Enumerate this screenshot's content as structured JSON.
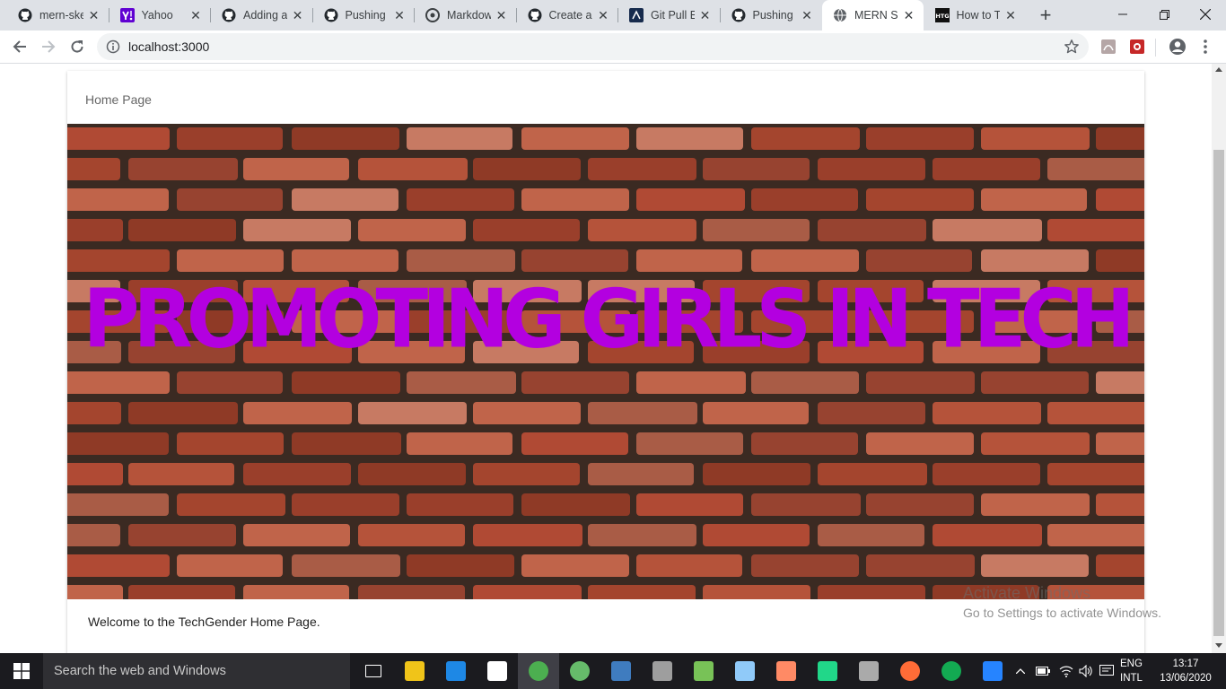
{
  "browser": {
    "tabs": [
      {
        "title": "mern-ske",
        "icon": "github-icon"
      },
      {
        "title": "Yahoo",
        "icon": "yahoo-icon"
      },
      {
        "title": "Adding a",
        "icon": "github-icon"
      },
      {
        "title": "Pushing",
        "icon": "github-icon"
      },
      {
        "title": "Markdow",
        "icon": "markdown-icon"
      },
      {
        "title": "Create a",
        "icon": "github-icon"
      },
      {
        "title": "Git Pull E",
        "icon": "atlassian-icon"
      },
      {
        "title": "Pushing y",
        "icon": "github-icon"
      },
      {
        "title": "MERN Sk",
        "icon": "globe-icon"
      },
      {
        "title": "How to T",
        "icon": "htg-icon"
      }
    ],
    "active_tab_index": 8,
    "url": "localhost:3000"
  },
  "page": {
    "header_title": "Home Page",
    "hero_text": "PROMOTING GIRLS IN TECH",
    "welcome_text": "Welcome to the TechGender Home Page."
  },
  "watermark": {
    "line1": "Activate Windows",
    "line2": "Go to Settings to activate Windows."
  },
  "taskbar": {
    "search_placeholder": "Search the web and Windows",
    "language_line1": "ENG",
    "language_line2": "INTL",
    "time": "13:17",
    "date": "13/06/2020",
    "apps": [
      {
        "name": "task-view",
        "color": "#ffffff"
      },
      {
        "name": "file-explorer",
        "color": "#f0c419"
      },
      {
        "name": "edge",
        "color": "#1e88e5"
      },
      {
        "name": "store",
        "color": "#ffffff"
      },
      {
        "name": "chrome",
        "color": "#4caf50"
      },
      {
        "name": "atom",
        "color": "#66bb6a"
      },
      {
        "name": "python",
        "color": "#3f7cbf"
      },
      {
        "name": "terminal",
        "color": "#9e9e9e"
      },
      {
        "name": "android-studio",
        "color": "#78c257"
      },
      {
        "name": "virtualbox",
        "color": "#90caf9"
      },
      {
        "name": "media-player",
        "color": "#ff8a65"
      },
      {
        "name": "pycharm",
        "color": "#21d789"
      },
      {
        "name": "cmd",
        "color": "#aaaaaa"
      },
      {
        "name": "postman",
        "color": "#ff6c37"
      },
      {
        "name": "mongodb-compass",
        "color": "#13aa52"
      },
      {
        "name": "sourcetree",
        "color": "#2684ff"
      }
    ]
  },
  "colors": {
    "hero_text": "#b300e0",
    "brick": "#a4452e",
    "mortar": "#3b2a22"
  }
}
